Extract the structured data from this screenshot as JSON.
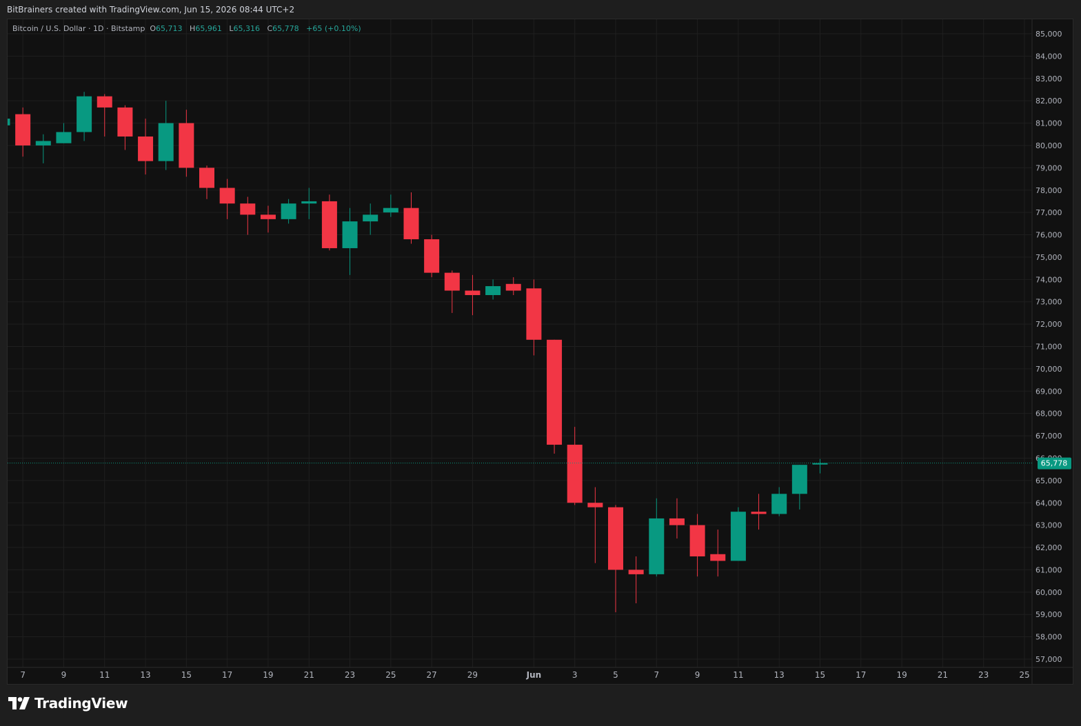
{
  "header": {
    "attribution": "BitBrainers created with TradingView.com, Jun 15, 2026 08:44 UTC+2"
  },
  "legend": {
    "symbol": "Bitcoin / U.S. Dollar · 1D · Bitstamp",
    "open_label": "O",
    "open": "65,713",
    "high_label": "H",
    "high": "65,961",
    "low_label": "L",
    "low": "65,316",
    "close_label": "C",
    "close": "65,778",
    "change": "+65 (+0.10%)"
  },
  "branding": {
    "logo_text": "TradingView"
  },
  "colors": {
    "up": "#089981",
    "down": "#f23645",
    "background": "#111111",
    "grid": "#1f1f1f",
    "text": "#b2b5be",
    "price_label": "#089981"
  },
  "chart_data": {
    "type": "candlestick",
    "ylim": [
      56500,
      85500
    ],
    "y_ticks": [
      "85,000",
      "84,000",
      "83,000",
      "82,000",
      "81,000",
      "80,000",
      "79,000",
      "78,000",
      "77,000",
      "76,000",
      "75,000",
      "74,000",
      "73,000",
      "72,000",
      "71,000",
      "70,000",
      "69,000",
      "68,000",
      "67,000",
      "66,000",
      "65,000",
      "64,000",
      "63,000",
      "62,000",
      "61,000",
      "60,000",
      "59,000",
      "58,000",
      "57,000"
    ],
    "x_labels": [
      "7",
      "9",
      "11",
      "13",
      "15",
      "17",
      "19",
      "21",
      "23",
      "25",
      "27",
      "29",
      "Jun",
      "3",
      "5",
      "7",
      "9",
      "11",
      "13",
      "15",
      "17",
      "19",
      "21",
      "23",
      "25"
    ],
    "last_price": "65,778",
    "candles": [
      {
        "date": "May 6",
        "o": 80900,
        "h": 81200,
        "l": 80700,
        "c": 81200
      },
      {
        "date": "May 7",
        "o": 81400,
        "h": 81700,
        "l": 79500,
        "c": 80000
      },
      {
        "date": "May 8",
        "o": 80000,
        "h": 80500,
        "l": 79200,
        "c": 80200
      },
      {
        "date": "May 9",
        "o": 80100,
        "h": 81000,
        "l": 80100,
        "c": 80600
      },
      {
        "date": "May 10",
        "o": 80600,
        "h": 82400,
        "l": 80200,
        "c": 82200
      },
      {
        "date": "May 11",
        "o": 82200,
        "h": 82300,
        "l": 80400,
        "c": 81700
      },
      {
        "date": "May 12",
        "o": 81700,
        "h": 81800,
        "l": 79800,
        "c": 80400
      },
      {
        "date": "May 13",
        "o": 80400,
        "h": 81200,
        "l": 78700,
        "c": 79300
      },
      {
        "date": "May 14",
        "o": 79300,
        "h": 82000,
        "l": 78900,
        "c": 81000
      },
      {
        "date": "May 15",
        "o": 81000,
        "h": 81600,
        "l": 78600,
        "c": 79000
      },
      {
        "date": "May 16",
        "o": 79000,
        "h": 79100,
        "l": 77600,
        "c": 78100
      },
      {
        "date": "May 17",
        "o": 78100,
        "h": 78500,
        "l": 76700,
        "c": 77400
      },
      {
        "date": "May 18",
        "o": 77400,
        "h": 77700,
        "l": 76000,
        "c": 76900
      },
      {
        "date": "May 19",
        "o": 76900,
        "h": 77300,
        "l": 76100,
        "c": 76700
      },
      {
        "date": "May 20",
        "o": 76700,
        "h": 77600,
        "l": 76500,
        "c": 77400
      },
      {
        "date": "May 21",
        "o": 77400,
        "h": 78100,
        "l": 76700,
        "c": 77500
      },
      {
        "date": "May 22",
        "o": 77500,
        "h": 77800,
        "l": 75300,
        "c": 75400
      },
      {
        "date": "May 23",
        "o": 75400,
        "h": 77200,
        "l": 74200,
        "c": 76600
      },
      {
        "date": "May 24",
        "o": 76600,
        "h": 77400,
        "l": 76000,
        "c": 76900
      },
      {
        "date": "May 25",
        "o": 77000,
        "h": 77800,
        "l": 76800,
        "c": 77200
      },
      {
        "date": "May 26",
        "o": 77200,
        "h": 77900,
        "l": 75600,
        "c": 75800
      },
      {
        "date": "May 27",
        "o": 75800,
        "h": 76000,
        "l": 74100,
        "c": 74300
      },
      {
        "date": "May 28",
        "o": 74300,
        "h": 74400,
        "l": 72500,
        "c": 73500
      },
      {
        "date": "May 29",
        "o": 73500,
        "h": 74200,
        "l": 72400,
        "c": 73300
      },
      {
        "date": "May 30",
        "o": 73300,
        "h": 74000,
        "l": 73100,
        "c": 73700
      },
      {
        "date": "May 31",
        "o": 73800,
        "h": 74100,
        "l": 73300,
        "c": 73500
      },
      {
        "date": "Jun 1",
        "o": 73600,
        "h": 74000,
        "l": 70600,
        "c": 71300
      },
      {
        "date": "Jun 2",
        "o": 71300,
        "h": 71300,
        "l": 66200,
        "c": 66600
      },
      {
        "date": "Jun 3",
        "o": 66600,
        "h": 67400,
        "l": 63900,
        "c": 64000
      },
      {
        "date": "Jun 4",
        "o": 64000,
        "h": 64700,
        "l": 61300,
        "c": 63800
      },
      {
        "date": "Jun 5",
        "o": 63800,
        "h": 63900,
        "l": 59100,
        "c": 61000
      },
      {
        "date": "Jun 6",
        "o": 61000,
        "h": 61600,
        "l": 59500,
        "c": 60800
      },
      {
        "date": "Jun 7",
        "o": 60800,
        "h": 64200,
        "l": 60700,
        "c": 63300
      },
      {
        "date": "Jun 8",
        "o": 63300,
        "h": 64200,
        "l": 62400,
        "c": 63000
      },
      {
        "date": "Jun 9",
        "o": 63000,
        "h": 63500,
        "l": 60700,
        "c": 61600
      },
      {
        "date": "Jun 10",
        "o": 61700,
        "h": 62800,
        "l": 60700,
        "c": 61400
      },
      {
        "date": "Jun 11",
        "o": 61400,
        "h": 63800,
        "l": 61400,
        "c": 63600
      },
      {
        "date": "Jun 12",
        "o": 63600,
        "h": 64400,
        "l": 62800,
        "c": 63500
      },
      {
        "date": "Jun 13",
        "o": 63500,
        "h": 64700,
        "l": 63400,
        "c": 64400
      },
      {
        "date": "Jun 14",
        "o": 64400,
        "h": 65700,
        "l": 63700,
        "c": 65700
      },
      {
        "date": "Jun 15",
        "o": 65713,
        "h": 65961,
        "l": 65316,
        "c": 65778
      }
    ]
  }
}
